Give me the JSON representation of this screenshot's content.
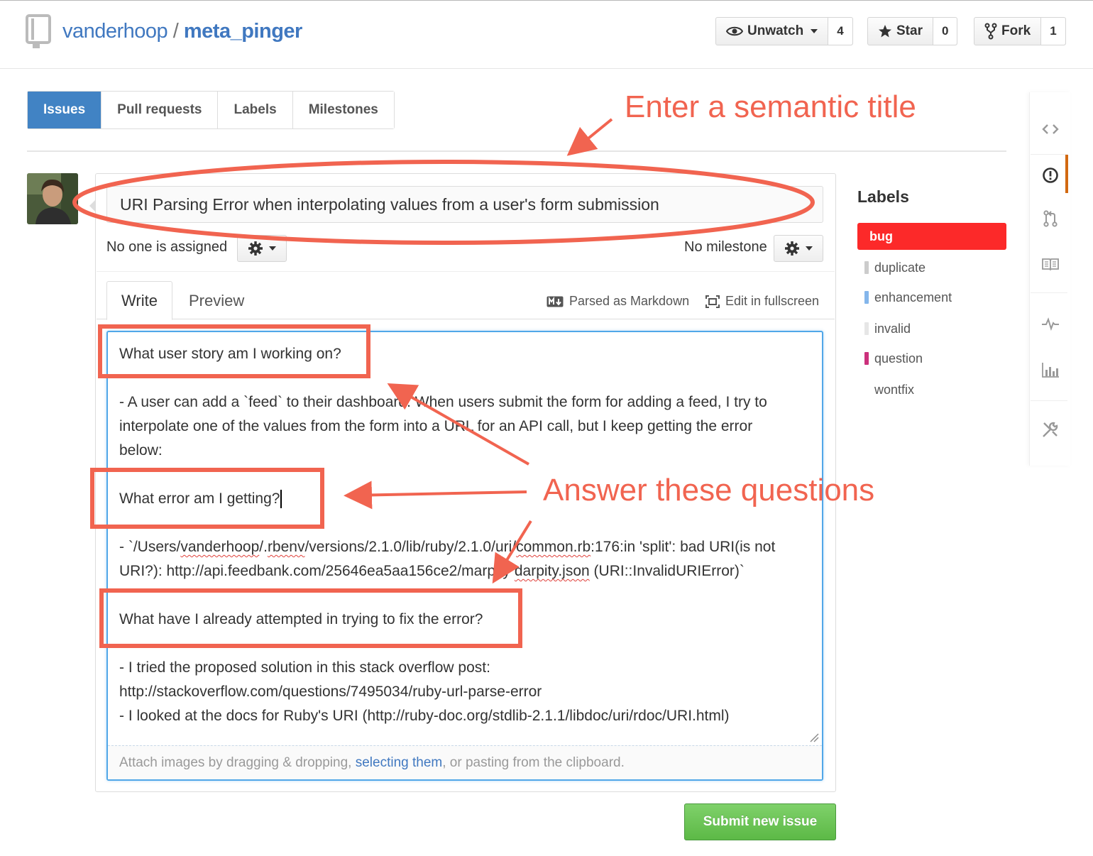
{
  "repo": {
    "owner": "vanderhoop",
    "separator": "/",
    "name": "meta_pinger"
  },
  "header_buttons": {
    "watch": {
      "label": "Unwatch",
      "count": "4",
      "icon": "eye-icon"
    },
    "star": {
      "label": "Star",
      "count": "0",
      "icon": "star-icon"
    },
    "fork": {
      "label": "Fork",
      "count": "1",
      "icon": "fork-icon"
    }
  },
  "tabs": [
    {
      "label": "Issues",
      "active": true
    },
    {
      "label": "Pull requests",
      "active": false
    },
    {
      "label": "Labels",
      "active": false
    },
    {
      "label": "Milestones",
      "active": false
    }
  ],
  "issue": {
    "title_value": "URI Parsing Error when interpolating values from a user's form submission",
    "assignee_text": "No one is assigned",
    "milestone_text": "No milestone"
  },
  "editor_tabs": {
    "write": "Write",
    "preview": "Preview"
  },
  "toolbar": {
    "markdown": "Parsed as Markdown",
    "fullscreen": "Edit in fullscreen"
  },
  "body_lines": {
    "q1": "What user story am I working on?",
    "a1_line1": " - A user can add a `feed` to their dashboard. When users submit the form for adding a feed, I try to",
    "a1_line2": "interpolate one of the values from the form into a URL for an API call, but I keep getting the error",
    "a1_line3": "below:",
    "q2": "What error am I getting?",
    "a2_line1_a": "- `/Users/",
    "a2_line1_b": "vanderhoop",
    "a2_line1_c": "/.",
    "a2_line1_d": "rbenv",
    "a2_line1_e": "/versions/2.1.0/lib/ruby/2.1.0/uri/",
    "a2_line1_f": "common.rb",
    "a2_line1_g": ":176:in 'split': bad URI(is not",
    "a2_line2_a": "URI?): http://api.feedbank.com/25646ea5aa156ce2/marpity ",
    "a2_line2_b": "darpity.json",
    "a2_line2_c": " (URI::InvalidURIError)`",
    "q3": "What have I already attempted in trying to fix the error?",
    "a3_line1": "- I tried the proposed solution in this stack overflow post:",
    "a3_line2": "http://stackoverflow.com/questions/7495034/ruby-url-parse-error",
    "a3_line3": "- I looked at the docs for Ruby's URI (http://ruby-doc.org/stdlib-2.1.1/libdoc/uri/rdoc/URI.html)"
  },
  "drop_zone": {
    "before": "Attach images by dragging & dropping, ",
    "link": "selecting them",
    "after": ", or pasting from the clipboard."
  },
  "submit_label": "Submit new issue",
  "labels": {
    "heading": "Labels",
    "items": [
      {
        "name": "bug",
        "color": "#fc2929",
        "selected": true
      },
      {
        "name": "duplicate",
        "color": "#cccccc",
        "selected": false
      },
      {
        "name": "enhancement",
        "color": "#84b6eb",
        "selected": false
      },
      {
        "name": "invalid",
        "color": "#e6e6e6",
        "selected": false
      },
      {
        "name": "question",
        "color": "#cc317c",
        "selected": false
      },
      {
        "name": "wontfix",
        "color": "#ffffff",
        "selected": false
      }
    ]
  },
  "right_nav_icons": [
    "code-icon",
    "issues-icon",
    "pull-request-icon",
    "wiki-icon",
    "pulse-icon",
    "graphs-icon",
    "settings-icon"
  ],
  "annotations": {
    "title_note": "Enter a semantic title",
    "questions_note": "Answer these questions",
    "color": "#f16450"
  }
}
